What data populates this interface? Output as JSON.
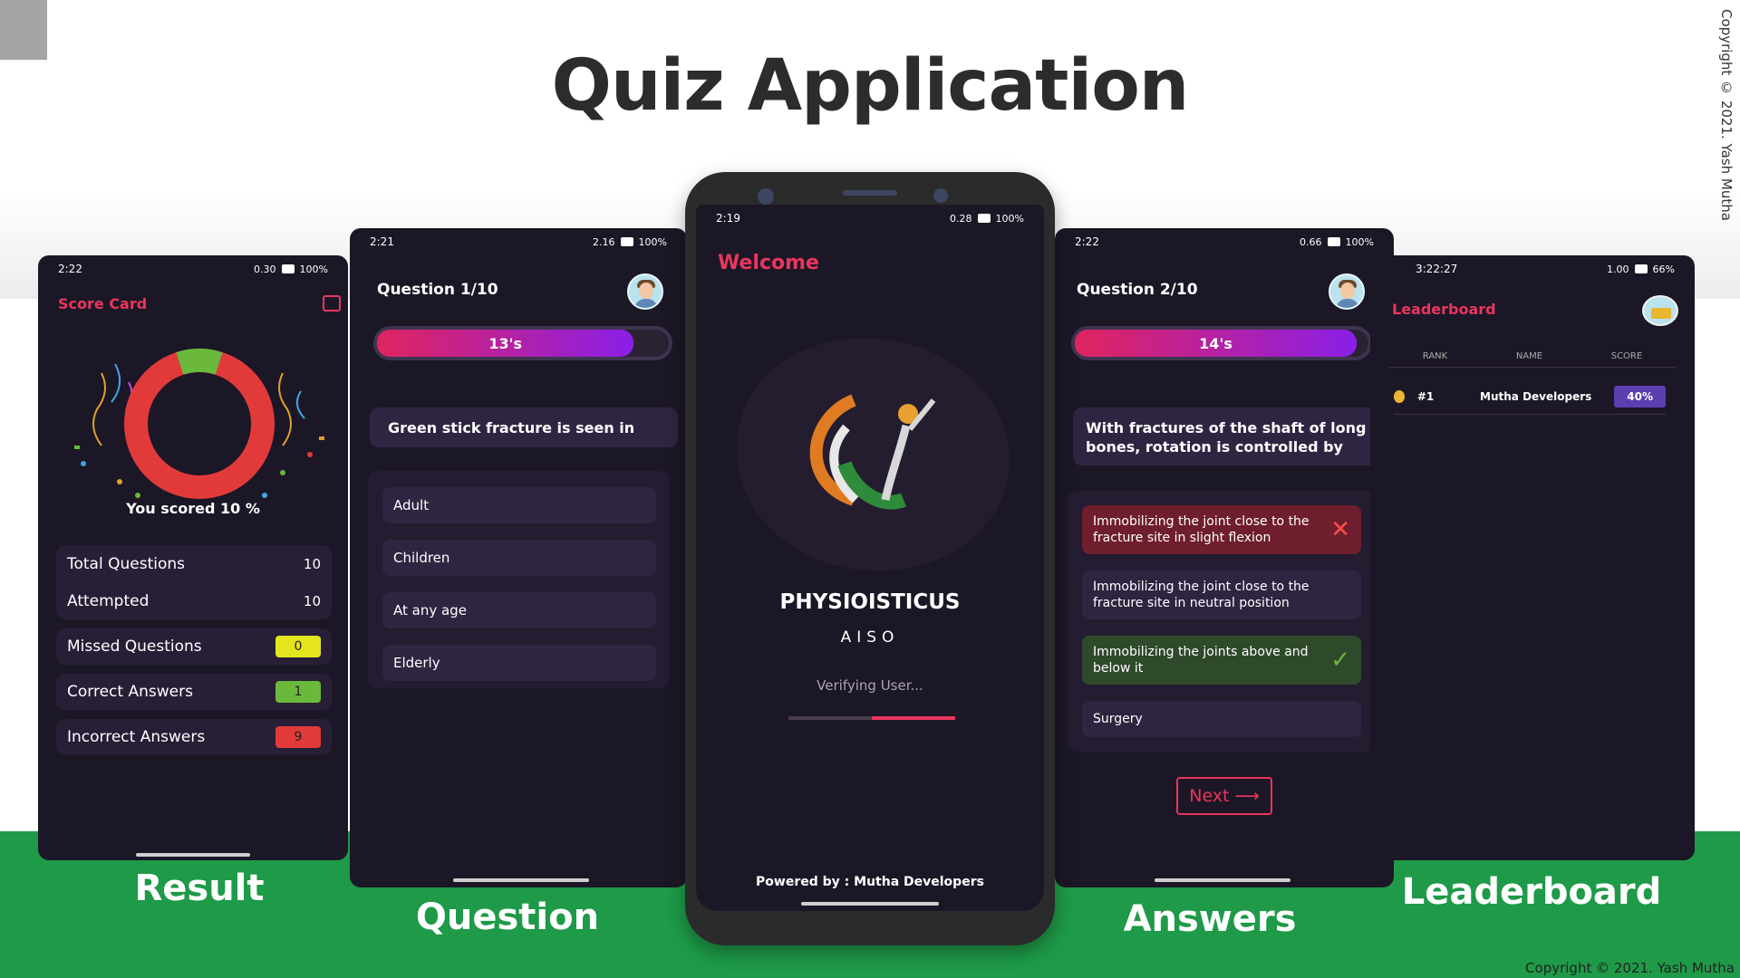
{
  "title": "Quiz Application",
  "copyright": "Copyright © 2021. Yash Mutha",
  "captions": {
    "result": "Result",
    "question": "Question",
    "answers": "Answers",
    "leaderboard": "Leaderboard"
  },
  "colors": {
    "accent": "#e8365e",
    "green": "#1e9a48",
    "screen_bg": "#1c1726",
    "card_bg": "#281f37"
  },
  "result_screen": {
    "time": "2:22",
    "net_speed": "0.30",
    "battery": "100%",
    "title": "Score Card",
    "score_text": "You scored 10 %",
    "donut": {
      "correct_fraction": 0.1
    },
    "rows": [
      {
        "label": "Total Questions",
        "value": "10"
      },
      {
        "label": "Attempted",
        "value": "10"
      },
      {
        "label": "Missed Questions",
        "value": "0",
        "color": "#e5e51e"
      },
      {
        "label": "Correct Answers",
        "value": "1",
        "color": "#6ab83c"
      },
      {
        "label": "Incorrect Answers",
        "value": "9",
        "color": "#e23a3a"
      }
    ]
  },
  "question_screen": {
    "time": "2:21",
    "net_speed": "2.16",
    "battery": "100%",
    "header": "Question 1/10",
    "timer": "13's",
    "timer_fraction": 0.88,
    "question": "Green stick fracture is seen in",
    "options": [
      "Adult",
      "Children",
      "At any age",
      "Elderly"
    ]
  },
  "welcome_screen": {
    "time": "2:19",
    "net_speed": "0.28",
    "battery": "100%",
    "heading": "Welcome",
    "app_name": "PHYSIOISTICUS",
    "subtitle": "AISO",
    "status": "Verifying User...",
    "progress_fraction": 0.5,
    "footer": "Powered by : Mutha Developers"
  },
  "answer_screen": {
    "time": "2:22",
    "net_speed": "0.66",
    "battery": "100%",
    "header": "Question 2/10",
    "timer": "14's",
    "timer_fraction": 0.96,
    "question": "With fractures of the shaft of long bones, rotation is controlled by",
    "options": [
      {
        "text": "Immobilizing the joint close to the fracture site in slight flexion",
        "state": "wrong"
      },
      {
        "text": "Immobilizing the joint close to the fracture site in neutral position",
        "state": "none"
      },
      {
        "text": "Immobilizing the joints above and below it",
        "state": "correct"
      },
      {
        "text": "Surgery",
        "state": "none"
      }
    ],
    "next_label": "Next"
  },
  "leaderboard_screen": {
    "time": "3:22:27",
    "net_speed": "1.00",
    "battery": "66%",
    "title": "Leaderboard",
    "columns": [
      "RANK",
      "NAME",
      "SCORE"
    ],
    "rows": [
      {
        "rank": "#1",
        "name": "Mutha Developers",
        "score": "40%"
      }
    ]
  }
}
